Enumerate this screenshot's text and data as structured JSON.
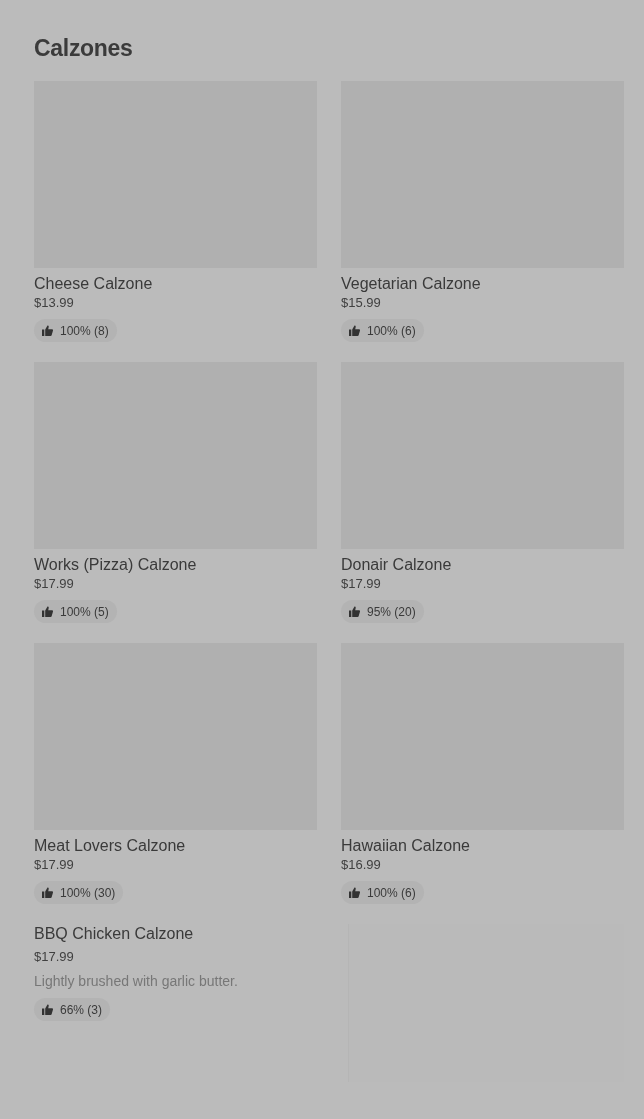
{
  "section": {
    "title": "Calzones"
  },
  "items": [
    {
      "kind": "tile",
      "name": "Cheese Calzone",
      "price": "$13.99",
      "rating": "100% (8)"
    },
    {
      "kind": "tile",
      "name": "Vegetarian Calzone",
      "price": "$15.99",
      "rating": "100% (6)"
    },
    {
      "kind": "tile",
      "name": "Works (Pizza) Calzone",
      "price": "$17.99",
      "rating": "100% (5)"
    },
    {
      "kind": "tile",
      "name": "Donair Calzone",
      "price": "$17.99",
      "rating": "95% (20)"
    },
    {
      "kind": "tile",
      "name": "Meat Lovers Calzone",
      "price": "$17.99",
      "rating": "100% (30)"
    },
    {
      "kind": "tile",
      "name": "Hawaiian Calzone",
      "price": "$16.99",
      "rating": "100% (6)"
    },
    {
      "kind": "row",
      "name": "BBQ Chicken Calzone",
      "price": "$17.99",
      "description": "Lightly brushed with garlic butter.",
      "rating": "66% (3)"
    }
  ]
}
